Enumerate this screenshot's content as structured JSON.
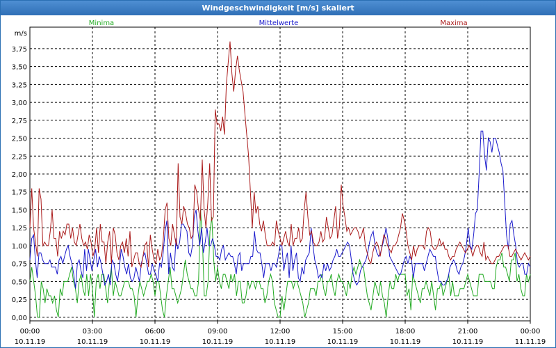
{
  "window": {
    "title": "Windgeschwindigkeit [m/s] skaliert"
  },
  "chart_data": {
    "type": "line",
    "ylabel": "m/s",
    "ylim": [
      -0.05,
      4.05
    ],
    "xlim": [
      0,
      144
    ],
    "grid": true,
    "y_ticks": [
      "0,00",
      "0,25",
      "0,50",
      "0,75",
      "1,00",
      "1,25",
      "1,50",
      "1,75",
      "2,00",
      "2,25",
      "2,50",
      "2,75",
      "3,00",
      "3,25",
      "3,50",
      "3,75"
    ],
    "x_ticks": [
      {
        "time": "00:00",
        "date": "10.11.19"
      },
      {
        "time": "03:00",
        "date": "10.11.19"
      },
      {
        "time": "06:00",
        "date": "10.11.19"
      },
      {
        "time": "09:00",
        "date": "10.11.19"
      },
      {
        "time": "12:00",
        "date": "10.11.19"
      },
      {
        "time": "15:00",
        "date": "10.11.19"
      },
      {
        "time": "18:00",
        "date": "10.11.19"
      },
      {
        "time": "21:00",
        "date": "10.11.19"
      },
      {
        "time": "00:00",
        "date": "11.11.19"
      }
    ],
    "series": [
      {
        "name": "Minima",
        "color": "#22aa22",
        "values": [
          0.5,
          0.7,
          0.5,
          0.3,
          0,
          0,
          0.5,
          0.4,
          0.2,
          0.4,
          0.3,
          0.3,
          0.2,
          0.3,
          0.1,
          0,
          0.4,
          0.3,
          0.5,
          0.5,
          0.5,
          0.6,
          0.7,
          0.5,
          0.4,
          0.2,
          0.5,
          0.6,
          0.4,
          0.3,
          0.6,
          0.3,
          0.6,
          0.4,
          0,
          0.5,
          0.6,
          0.4,
          0.6,
          0.6,
          0.4,
          0.2,
          0.5,
          0.7,
          0.3,
          0.5,
          0.4,
          0.3,
          0.3,
          0.4,
          0.5,
          0.5,
          0.5,
          0.4,
          0.4,
          0.3,
          0,
          0.3,
          0.5,
          0.4,
          0.3,
          0.4,
          0.5,
          0.5,
          0.6,
          0.5,
          0.3,
          0.5,
          0.5,
          0.3,
          0.1,
          0,
          0.3,
          0.5,
          0.7,
          0.4,
          0.4,
          0.3,
          0.2,
          0.3,
          0.4,
          0.6,
          0.8,
          0.6,
          0.5,
          0.4,
          0.4,
          0.3,
          0.3,
          0.5,
          1.5,
          1.1,
          0.3,
          0.3,
          0.5,
          1.2,
          1.4,
          0.8,
          0.5,
          0.7,
          0.5,
          0.4,
          0.6,
          0.6,
          0.5,
          0.4,
          0.6,
          0.5,
          0.6,
          0.3,
          0.5,
          0.5,
          0.2,
          0.2,
          0.3,
          0.5,
          0.4,
          0.5,
          0.5,
          0.4,
          0.5,
          0.5,
          0.4,
          0.4,
          0.2,
          0.3,
          0.5,
          0.6,
          0.5,
          0.2,
          0.1,
          0,
          0,
          0.3,
          0.1,
          0.3,
          0.5,
          0.5,
          0.5,
          0.4,
          0.5,
          0.5,
          0.4,
          0.3,
          0.2,
          0,
          0.1,
          0.2,
          0.4,
          0.4,
          0.4,
          0.3,
          0.5,
          0.5,
          0.6,
          0.4,
          0.3,
          0.5,
          0.5,
          0.6,
          0.4,
          0.3,
          0.5,
          0.6,
          0.5,
          0.5,
          0.4,
          0.3,
          0.5,
          0.4,
          0.6,
          0.7,
          0.6,
          0.7,
          0.8,
          0.7,
          0.7,
          0.5,
          0.3,
          0.2,
          0.1,
          0.3,
          0.5,
          0.4,
          0.3,
          0.5,
          0.3,
          0.2,
          0,
          0.3,
          0.5,
          0.4,
          0.4,
          0.6,
          0.5,
          0.6,
          0.6,
          0.6,
          0.6,
          0.3,
          0.4,
          0.1,
          0.6,
          0.5,
          0.4,
          0.3,
          0.2,
          0.4,
          0.4,
          0.5,
          0.4,
          0.3,
          0.5,
          0.3,
          0.1,
          0.4,
          0.4,
          0.5,
          0.3,
          0.4,
          0.5,
          0.6,
          0.3,
          0.5,
          0.3,
          0.3,
          0.3,
          0.4,
          0.4,
          0.4,
          0.5,
          0.6,
          0.5,
          0.4,
          0.3,
          0.3,
          0.3,
          0.6,
          0.6,
          0.6,
          0.5,
          0.5,
          0.5,
          0.5,
          0.4,
          0.4,
          0.7,
          0.8,
          0.8,
          0.9,
          0.7,
          0.7,
          0.6,
          0.5,
          0.8,
          0.8,
          0.9,
          0.5,
          0.6,
          0.4,
          0.3,
          0.3,
          0.6,
          0.5,
          0.6
        ]
      },
      {
        "name": "Mittelwerte",
        "color": "#1a1acc",
        "values": [
          0.8,
          1.1,
          1.15,
          0.8,
          0.55,
          0.9,
          0.9,
          0.8,
          0.75,
          0.75,
          0.75,
          0.8,
          0.7,
          0.7,
          0.7,
          0.6,
          0.8,
          0.85,
          0.75,
          0.85,
          0.95,
          1.0,
          0.85,
          0.75,
          0.6,
          0.4,
          0.75,
          0.8,
          0.65,
          0.55,
          0.95,
          0.65,
          0.95,
          0.8,
          0.65,
          0.8,
          0.95,
          0.7,
          0.85,
          0.75,
          0.6,
          0.45,
          0.5,
          0.6,
          0.45,
          0.8,
          0.75,
          0.6,
          0.5,
          0.7,
          0.95,
          0.85,
          0.7,
          0.6,
          0.75,
          0.55,
          0.5,
          0.55,
          0.7,
          0.6,
          0.5,
          0.75,
          0.85,
          0.9,
          0.75,
          0.6,
          0.6,
          0.75,
          0.65,
          0.6,
          0.5,
          0.75,
          0.7,
          0.9,
          1.2,
          1.35,
          0.6,
          0.9,
          0.7,
          0.65,
          1.1,
          0.95,
          1.05,
          1.3,
          1.3,
          1.25,
          1.2,
          0.9,
          0.85,
          1.0,
          1.4,
          1.5,
          1.2,
          1.0,
          1.25,
          0.9,
          1.05,
          1.25,
          1.0,
          1.0,
          1.1,
          1.0,
          0.85,
          0.85,
          0.8,
          0.95,
          1.0,
          0.8,
          0.85,
          0.9,
          0.85,
          0.85,
          0.75,
          0.6,
          0.85,
          0.9,
          0.65,
          0.75,
          0.75,
          0.75,
          0.75,
          0.85,
          0.85,
          1.2,
          0.95,
          0.9,
          0.9,
          0.75,
          0.55,
          0.75,
          0.75,
          0.75,
          0.65,
          0.75,
          0.75,
          0.7,
          0.85,
          1.0,
          1.0,
          0.65,
          0.8,
          0.9,
          0.55,
          1.0,
          0.65,
          0.8,
          0.9,
          0.55,
          0.5,
          0.7,
          0.6,
          0.8,
          0.85,
          0.9,
          1.25,
          1.0,
          0.8,
          0.7,
          0.55,
          0.6,
          0.55,
          0.75,
          0.65,
          0.75,
          0.65,
          0.7,
          0.8,
          0.85,
          0.95,
          0.85,
          0.85,
          0.9,
          0.95,
          1.0,
          1.05,
          1.0,
          0.8,
          0.6,
          0.5,
          0.45,
          0.5,
          0.65,
          0.7,
          0.75,
          0.8,
          0.9,
          1.05,
          1.15,
          1.2,
          1.0,
          0.9,
          0.85,
          0.9,
          1.0,
          1.1,
          1.25,
          1.1,
          0.85,
          0.8,
          0.75,
          0.7,
          0.65,
          0.6,
          0.6,
          0.7,
          0.8,
          0.85,
          0.75,
          0.85,
          0.8,
          0.55,
          0.75,
          0.75,
          0.75,
          0.75,
          0.75,
          0.65,
          0.75,
          0.85,
          0.95,
          0.9,
          0.85,
          0.85,
          0.65,
          0.5,
          0.5,
          0.45,
          0.45,
          0.5,
          0.55,
          0.7,
          0.75,
          0.8,
          0.75,
          0.65,
          0.6,
          0.7,
          0.75,
          0.85,
          1.0,
          1.25,
          1.0,
          0.95,
          1.15,
          1.45,
          1.5,
          2.0,
          2.6,
          2.6,
          2.25,
          2.05,
          2.5,
          2.45,
          2.3,
          2.5,
          2.5,
          2.4,
          2.3,
          2.15,
          2.05,
          1.6,
          1.15,
          0.95,
          1.3,
          1.35,
          1.15,
          1.0,
          0.75,
          0.7,
          0.75,
          0.75,
          0.6,
          0.6,
          0.75,
          0.7
        ]
      },
      {
        "name": "Maxima",
        "color": "#aa1a1a",
        "values": [
          1.25,
          1.8,
          1.25,
          1.05,
          0.85,
          1.8,
          1.65,
          1.0,
          1.05,
          1.0,
          1.0,
          1.2,
          1.5,
          1.1,
          1.1,
          0.85,
          1.2,
          1.1,
          1.2,
          1.15,
          1.3,
          1.3,
          1.1,
          1.25,
          1.05,
          1.0,
          1.15,
          1.3,
          1.1,
          1.0,
          1.05,
          0.95,
          1.15,
          1.05,
          0.85,
          0.95,
          1.25,
          0.9,
          1.3,
          1.05,
          1.05,
          0.75,
          1.05,
          1.2,
          0.75,
          1.25,
          1.15,
          0.9,
          0.8,
          1.0,
          1.05,
          0.9,
          1.1,
          0.85,
          1.2,
          0.7,
          0.8,
          0.9,
          0.9,
          0.75,
          0.7,
          0.85,
          1.0,
          1.05,
          0.7,
          1.15,
          0.95,
          0.8,
          0.75,
          0.95,
          0.8,
          0.85,
          1.1,
          1.5,
          1.6,
          1.1,
          1.0,
          1.3,
          1.15,
          1.0,
          2.15,
          1.4,
          1.3,
          1.55,
          1.45,
          1.3,
          1.25,
          1.1,
          1.15,
          1.85,
          1.75,
          1.5,
          1.35,
          2.2,
          1.5,
          1.25,
          1.6,
          2.15,
          1.35,
          1.4,
          2.9,
          2.7,
          2.7,
          2.6,
          2.8,
          2.55,
          3.25,
          3.55,
          3.85,
          3.4,
          3.15,
          3.45,
          3.65,
          3.45,
          3.3,
          3.15,
          2.85,
          2.55,
          2.25,
          1.75,
          1.25,
          1.75,
          1.45,
          1.55,
          1.3,
          1.2,
          1.35,
          1.15,
          1.0,
          1.0,
          1.0,
          1.05,
          1.0,
          1.35,
          1.2,
          1.1,
          1.0,
          1.1,
          1.2,
          1.05,
          1.0,
          1.3,
          1.0,
          1.1,
          1.1,
          1.25,
          1.05,
          1.1,
          1.5,
          1.75,
          1.4,
          1.15,
          1.2,
          1.05,
          1.0,
          1.0,
          1.05,
          1.2,
          1.05,
          1.1,
          1.4,
          1.25,
          1.1,
          1.15,
          1.35,
          1.55,
          1.1,
          1.25,
          1.85,
          1.55,
          1.4,
          1.2,
          1.25,
          1.15,
          1.2,
          1.25,
          1.25,
          1.2,
          1.1,
          1.15,
          1.25,
          1.0,
          0.9,
          0.8,
          0.75,
          0.9,
          1.0,
          1.05,
          1.0,
          0.85,
          1.0,
          1.15,
          1.1,
          1.0,
          0.95,
          0.9,
          1.0,
          1.0,
          1.05,
          1.15,
          1.25,
          1.45,
          1.35,
          1.2,
          1.0,
          0.9,
          0.8,
          1.0,
          0.85,
          0.95,
          1.0,
          1.0,
          1.0,
          0.95,
          1.2,
          1.25,
          1.2,
          1.0,
          0.95,
          0.95,
          1.0,
          1.1,
          1.0,
          1.05,
          0.95,
          0.95,
          0.85,
          0.8,
          0.85,
          0.85,
          0.95,
          1.0,
          1.05,
          1.0,
          0.95,
          0.9,
          0.95,
          1.0,
          0.95,
          0.85,
          0.95,
          1.0,
          1.0,
          0.9,
          0.85,
          1.05,
          0.8,
          0.85,
          0.8,
          0.75,
          0.75,
          0.8,
          0.85,
          0.85,
          0.9,
          0.95,
          1.0,
          1.0,
          1.0,
          0.85,
          0.85,
          0.9,
          0.95,
          0.9,
          0.85,
          0.8,
          0.85,
          0.9,
          0.85,
          0.8,
          0.85
        ]
      }
    ]
  }
}
